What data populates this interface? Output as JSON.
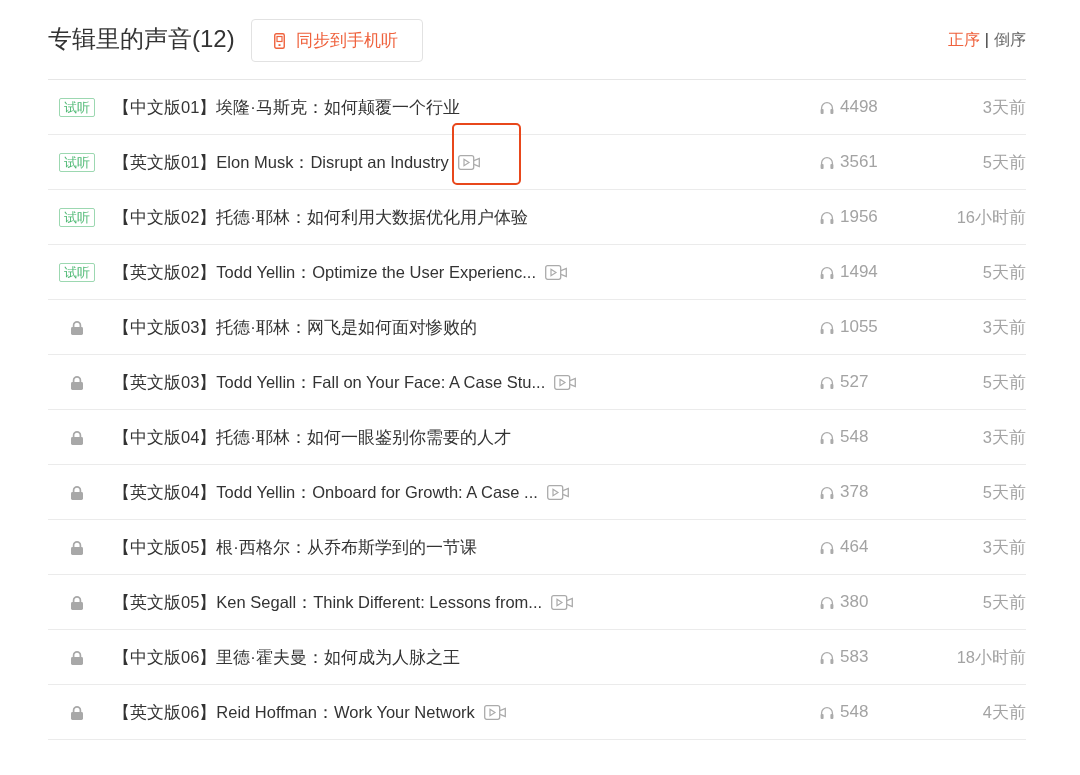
{
  "header": {
    "title": "专辑里的声音(12)",
    "sync_button": {
      "label": "同步到手机听"
    },
    "sort": [
      {
        "label": "正序",
        "selected": true
      },
      {
        "label": "倒序",
        "selected": false
      }
    ],
    "sort_separator": "|"
  },
  "rows": [
    {
      "kind": "trial",
      "badge": "试听",
      "title": "【中文版01】埃隆·马斯克：如何颠覆一个行业",
      "video": false,
      "highlighted": false,
      "plays": "4498",
      "time": "3天前"
    },
    {
      "kind": "trial",
      "badge": "试听",
      "title": "【英文版01】Elon Musk：Disrupt an Industry",
      "video": true,
      "highlighted": true,
      "plays": "3561",
      "time": "5天前"
    },
    {
      "kind": "trial",
      "badge": "试听",
      "title": "【中文版02】托德·耶林：如何利用大数据优化用户体验",
      "video": false,
      "highlighted": false,
      "plays": "1956",
      "time": "16小时前"
    },
    {
      "kind": "trial",
      "badge": "试听",
      "title": "【英文版02】Todd Yellin：Optimize the User Experienc...",
      "video": true,
      "highlighted": false,
      "plays": "1494",
      "time": "5天前"
    },
    {
      "kind": "locked",
      "title": "【中文版03】托德·耶林：网飞是如何面对惨败的",
      "video": false,
      "highlighted": false,
      "plays": "1055",
      "time": "3天前"
    },
    {
      "kind": "locked",
      "title": "【英文版03】Todd Yellin：Fall on Your Face: A Case Stu...",
      "video": true,
      "highlighted": false,
      "plays": "527",
      "time": "5天前"
    },
    {
      "kind": "locked",
      "title": "【中文版04】托德·耶林：如何一眼鉴别你需要的人才",
      "video": false,
      "highlighted": false,
      "plays": "548",
      "time": "3天前"
    },
    {
      "kind": "locked",
      "title": "【英文版04】Todd Yellin：Onboard for Growth: A Case ...",
      "video": true,
      "highlighted": false,
      "plays": "378",
      "time": "5天前"
    },
    {
      "kind": "locked",
      "title": "【中文版05】根·西格尔：从乔布斯学到的一节课",
      "video": false,
      "highlighted": false,
      "plays": "464",
      "time": "3天前"
    },
    {
      "kind": "locked",
      "title": "【英文版05】Ken Segall：Think Different: Lessons from...",
      "video": true,
      "highlighted": false,
      "plays": "380",
      "time": "5天前"
    },
    {
      "kind": "locked",
      "title": "【中文版06】里德·霍夫曼：如何成为人脉之王",
      "video": false,
      "highlighted": false,
      "plays": "583",
      "time": "18小时前"
    },
    {
      "kind": "locked",
      "title": "【英文版06】Reid Hoffman：Work Your Network",
      "video": true,
      "highlighted": false,
      "plays": "548",
      "time": "4天前"
    }
  ]
}
